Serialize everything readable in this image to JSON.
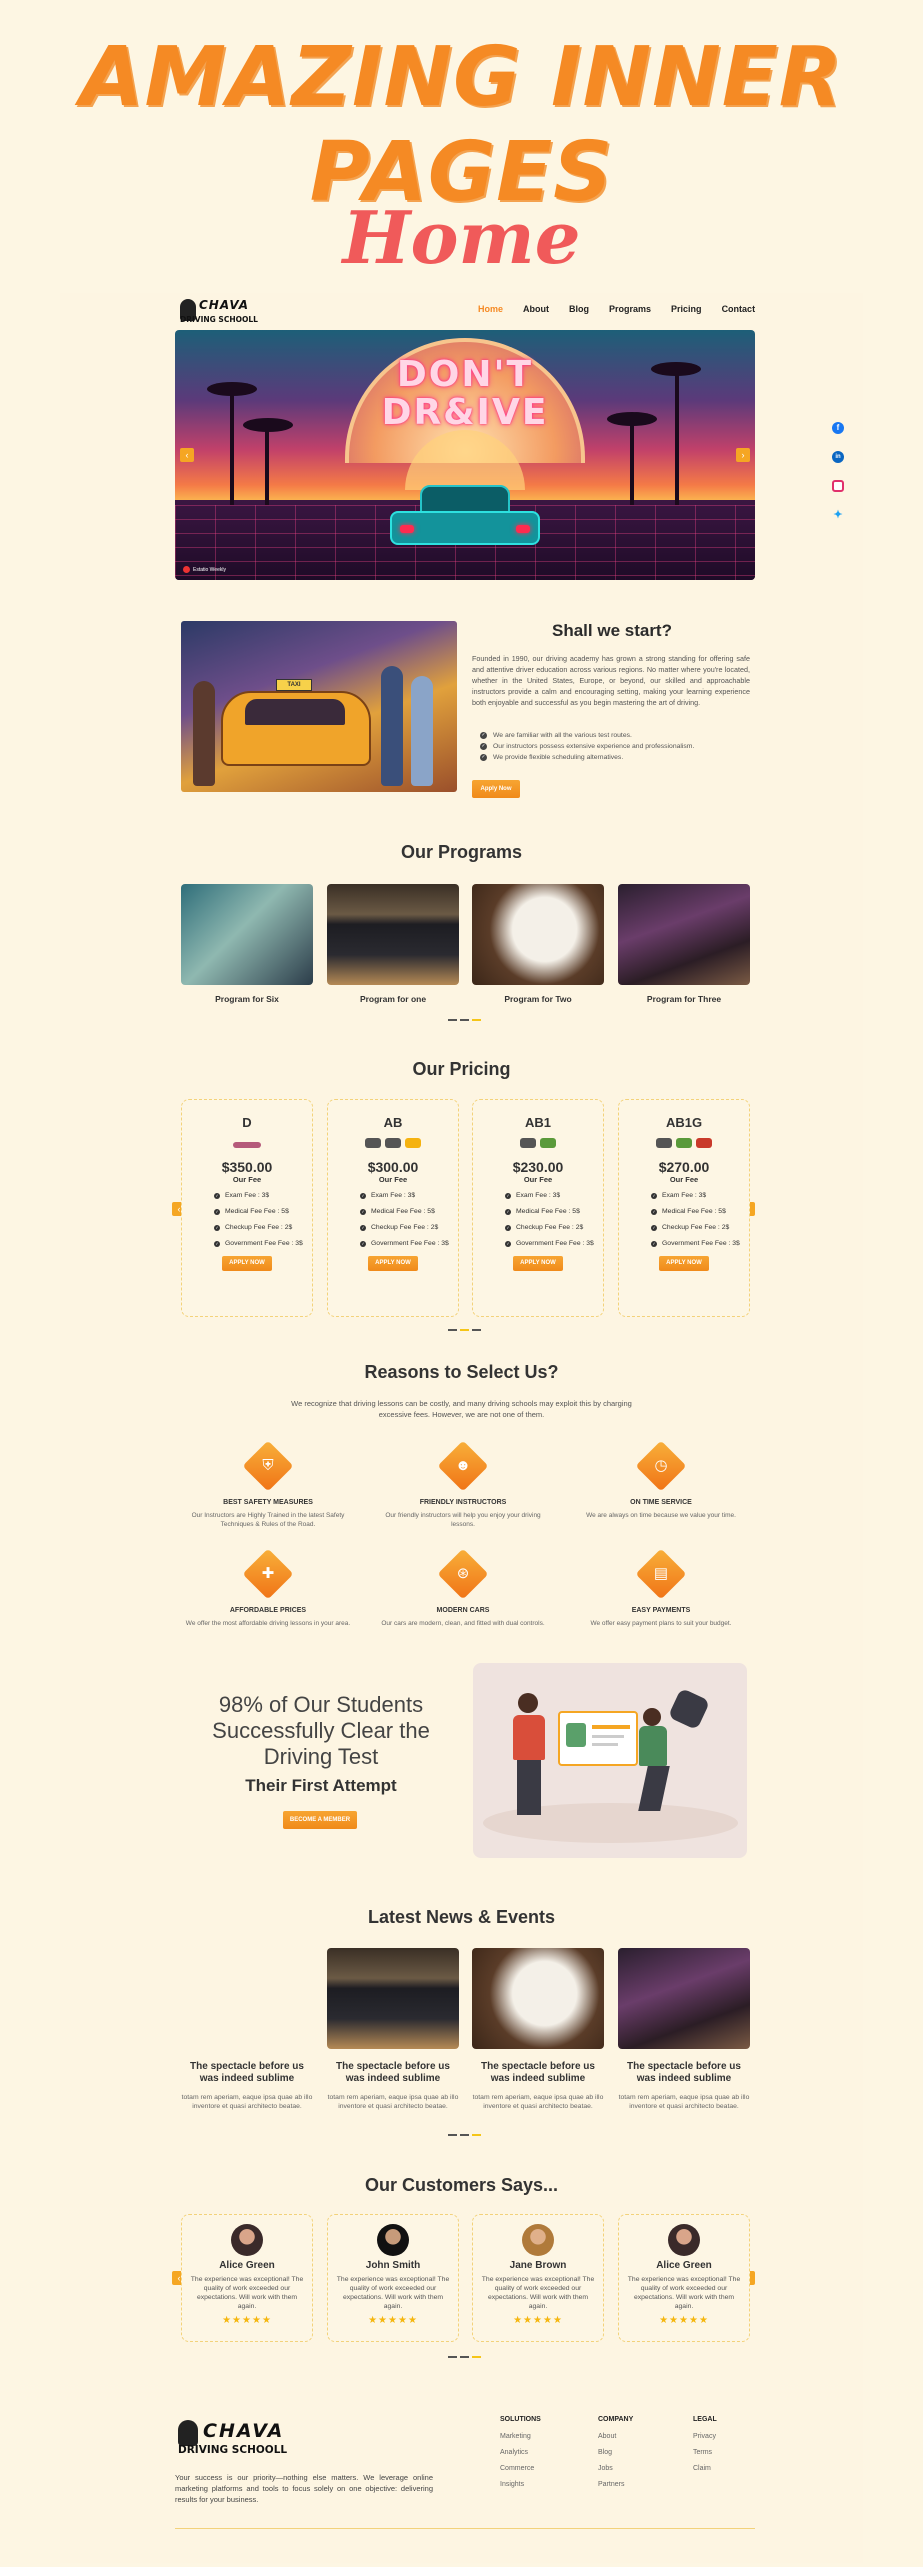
{
  "promo": {
    "title": "Amazing Inner Pages",
    "subtitle": "Home"
  },
  "brand": {
    "name": "CHAVA",
    "tagline": "DRIVING SCHOOLL"
  },
  "nav": [
    "Home",
    "About",
    "Blog",
    "Programs",
    "Pricing",
    "Contact"
  ],
  "hero": {
    "headline_1": "DON'T",
    "headline_2": "DR&IVE",
    "credit": "Estatio Weekly"
  },
  "social": [
    "facebook-icon",
    "linkedin-icon",
    "instagram-icon",
    "twitter-icon"
  ],
  "about": {
    "title": "Shall we start?",
    "text": "Founded in 1990, our driving academy has grown a strong standing for offering safe and attentive driver education across various regions. No matter where you're located, whether in the United States, Europe, or beyond, our skilled and approachable instructors provide a calm and encouraging setting, making your learning experience both enjoyable and successful as you begin mastering the art of driving.",
    "checks": [
      "We are familiar with all the various test routes.",
      "Our instructors possess extensive experience and professionalism.",
      "We provide flexible scheduling alternatives."
    ],
    "button": "Apply Now"
  },
  "programs": {
    "title": "Our Programs",
    "items": [
      "Program for Six",
      "Program for one",
      "Program for Two",
      "Program for Three"
    ]
  },
  "pricing": {
    "title": "Our Pricing",
    "fee_label": "Our Fee",
    "button": "APPLY NOW",
    "plans": [
      {
        "name": "D",
        "price": "$350.00",
        "items": [
          "Exam Fee : 3$",
          "Medical Fee Fee : 5$",
          "Checkup Fee Fee : 2$",
          "Government Fee Fee : 3$"
        ]
      },
      {
        "name": "AB",
        "price": "$300.00",
        "items": [
          "Exam Fee : 3$",
          "Medical Fee Fee : 5$",
          "Checkup Fee Fee : 2$",
          "Government Fee Fee : 3$"
        ]
      },
      {
        "name": "AB1",
        "price": "$230.00",
        "items": [
          "Exam Fee : 3$",
          "Medical Fee Fee : 5$",
          "Checkup Fee Fee : 2$",
          "Government Fee Fee : 3$"
        ]
      },
      {
        "name": "AB1G",
        "price": "$270.00",
        "items": [
          "Exam Fee : 3$",
          "Medical Fee Fee : 5$",
          "Checkup Fee Fee : 2$",
          "Government Fee Fee : 3$"
        ]
      }
    ]
  },
  "reasons": {
    "title": "Reasons to Select Us?",
    "intro": "We recognize that driving lessons can be costly, and many driving schools may exploit this by charging excessive fees. However, we are not one of them.",
    "items": [
      {
        "title": "BEST SAFETY MEASURES",
        "text": "Our Instructors are Highly Trained in the latest Safety Techniques & Rules of the Road.",
        "icon": "shield-icon"
      },
      {
        "title": "FRIENDLY INSTRUCTORS",
        "text": "Our friendly instructors will help you enjoy your driving lessons.",
        "icon": "people-icon"
      },
      {
        "title": "ON TIME SERVICE",
        "text": "We are always on time because we value your time.",
        "icon": "clock-icon"
      },
      {
        "title": "AFFORDABLE PRICES",
        "text": "We offer the most affordable driving lessons in your area.",
        "icon": "tag-icon"
      },
      {
        "title": "MODERN CARS",
        "text": "Our cars are modern, clean, and fitted with dual controls.",
        "icon": "steering-wheel-icon"
      },
      {
        "title": "EASY PAYMENTS",
        "text": "We offer easy payment plans to suit your budget.",
        "icon": "payment-icon"
      }
    ]
  },
  "stats": {
    "line": "98% of Our Students Successfully Clear the Driving Test",
    "sub": "Their First Attempt",
    "button": "BECOME A MEMBER"
  },
  "news": {
    "title": "Latest News & Events",
    "items": [
      {
        "title": "The spectacle before us was indeed sublime",
        "text": "totam rem aperiam, eaque ipsa quae ab illo inventore et quasi architecto beatae."
      },
      {
        "title": "The spectacle before us was indeed sublime",
        "text": "totam rem aperiam, eaque ipsa quae ab illo inventore et quasi architecto beatae."
      },
      {
        "title": "The spectacle before us was indeed sublime",
        "text": "totam rem aperiam, eaque ipsa quae ab illo inventore et quasi architecto beatae."
      },
      {
        "title": "The spectacle before us was indeed sublime",
        "text": "totam rem aperiam, eaque ipsa quae ab illo inventore et quasi architecto beatae."
      }
    ]
  },
  "testimonials": {
    "title": "Our Customers Says...",
    "items": [
      {
        "name": "Alice Green",
        "text": "The experience was exceptional! The quality of work exceeded our expectations. Will work with them again.",
        "stars": "★★★★★"
      },
      {
        "name": "John Smith",
        "text": "The experience was exceptional! The quality of work exceeded our expectations. Will work with them again.",
        "stars": "★★★★★"
      },
      {
        "name": "Jane Brown",
        "text": "The experience was exceptional! The quality of work exceeded our expectations. Will work with them again.",
        "stars": "★★★★★"
      },
      {
        "name": "Alice Green",
        "text": "The experience was exceptional! The quality of work exceeded our expectations. Will work with them again.",
        "stars": "★★★★★"
      }
    ]
  },
  "footer": {
    "text": "Your success is our priority—nothing else matters. We leverage online marketing platforms and tools to focus solely on one objective: delivering results for your business.",
    "columns": [
      {
        "title": "SOLUTIONS",
        "links": [
          "Marketing",
          "Analytics",
          "Commerce",
          "Insights"
        ]
      },
      {
        "title": "COMPANY",
        "links": [
          "About",
          "Blog",
          "Jobs",
          "Partners"
        ]
      },
      {
        "title": "LEGAL",
        "links": [
          "Privacy",
          "Terms",
          "Claim"
        ]
      }
    ]
  },
  "colors": {
    "accent": "#f58a24",
    "background": "#fdf6e3",
    "card_border": "#f3d27a"
  }
}
